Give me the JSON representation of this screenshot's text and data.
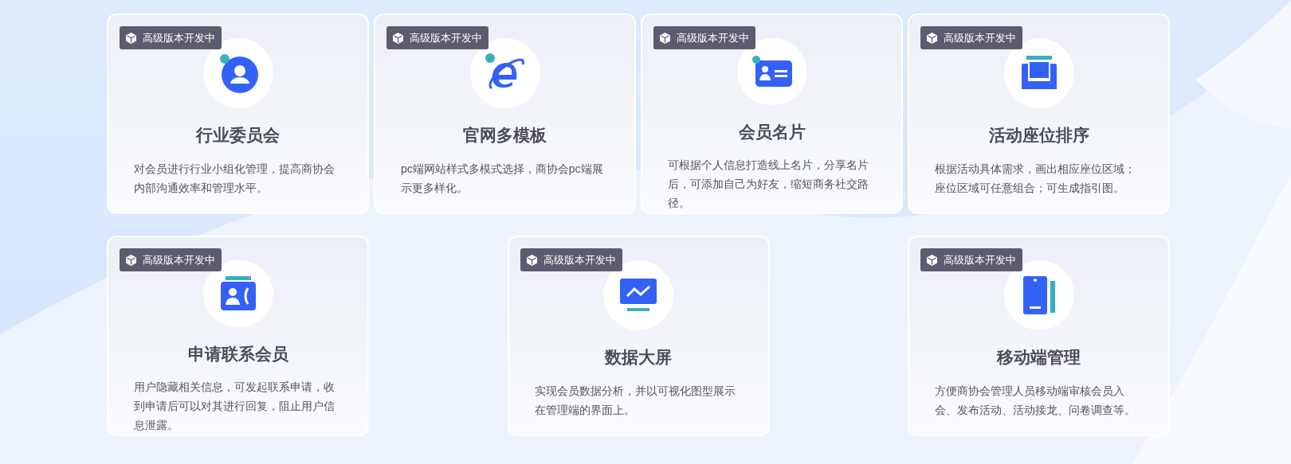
{
  "rows": [
    {
      "cards": [
        {
          "kind": "person",
          "badge": "高级版本开发中",
          "title": "行业委员会",
          "description": "对会员进行行业小组化管理，提高商协会内部沟通效率和管理水平。"
        },
        {
          "kind": "browser",
          "badge": "高级版本开发中",
          "title": "官网多模板",
          "description": "pc端网站样式多模式选择，商协会pc端展示更多样化。"
        },
        {
          "kind": "idcard",
          "badge": "高级版本开发中",
          "title": "会员名片",
          "description": "可根据个人信息打造线上名片，分享名片后，可添加自己为好友，缩短商务社交路径。"
        },
        {
          "kind": "seat",
          "badge": "高级版本开发中",
          "title": "活动座位排序",
          "description": "根据活动具体需求，画出相应座位区域；座位区域可任意组合；可生成指引图。"
        }
      ]
    },
    {
      "cards": [
        {
          "kind": "contact",
          "badge": "高级版本开发中",
          "title": "申请联系会员",
          "description": "用户隐藏相关信息，可发起联系申请，收到申请后可以对其进行回复，阻止用户信息泄露。"
        },
        {
          "kind": "monitor",
          "badge": "高级版本开发中",
          "title": "数据大屏",
          "description": "实现会员数据分析，并以可视化图型展示在管理端的界面上。"
        },
        {
          "kind": "phone",
          "badge": "高级版本开发中",
          "title": "移动端管理",
          "description": "方便商协会管理人员移动端审核会员入会、发布活动、活动接龙、问卷调查等。"
        }
      ]
    }
  ]
}
